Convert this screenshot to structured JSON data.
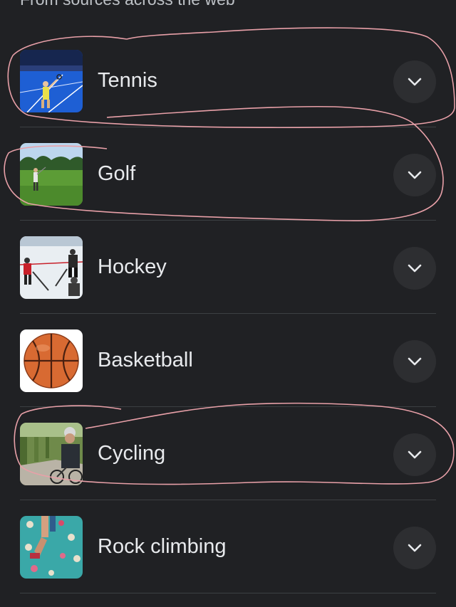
{
  "header": {
    "text": "From sources across the web"
  },
  "items": [
    {
      "label": "Tennis",
      "thumb_icon": "tennis-photo",
      "expand_icon": "chevron-down-icon"
    },
    {
      "label": "Golf",
      "thumb_icon": "golf-photo",
      "expand_icon": "chevron-down-icon"
    },
    {
      "label": "Hockey",
      "thumb_icon": "hockey-photo",
      "expand_icon": "chevron-down-icon"
    },
    {
      "label": "Basketball",
      "thumb_icon": "basketball-photo",
      "expand_icon": "chevron-down-icon"
    },
    {
      "label": "Cycling",
      "thumb_icon": "cycling-photo",
      "expand_icon": "chevron-down-icon"
    },
    {
      "label": "Rock climbing",
      "thumb_icon": "rock-climbing-photo",
      "expand_icon": "chevron-down-icon"
    }
  ],
  "colors": {
    "background": "#202124",
    "divider": "#3c4043",
    "text": "#e8eaed",
    "annotation": "#e8a0a8"
  }
}
